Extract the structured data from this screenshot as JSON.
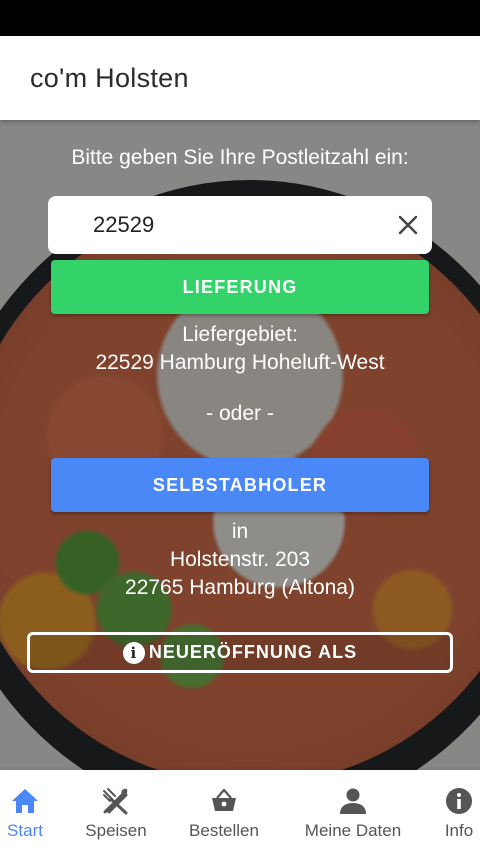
{
  "app": {
    "title": "co'm Holsten"
  },
  "zip_prompt": "Bitte geben Sie Ihre Postleitzahl ein:",
  "zip_input": {
    "value": "22529"
  },
  "delivery": {
    "button_label": "LIEFERUNG",
    "area_label": "Liefergebiet:",
    "area_value": "22529 Hamburg Hoheluft-West"
  },
  "or_text": "- oder -",
  "pickup": {
    "button_label": "SELBSTABHOLER",
    "in_label": "in",
    "street": "Holstenstr. 203",
    "city": "22765 Hamburg (Altona)"
  },
  "opening_button_label": "NEUERÖFFNUNG ALS",
  "colors": {
    "green": "#33d369",
    "blue": "#4a87f7"
  },
  "bottom_nav": {
    "items": [
      {
        "label": "Start",
        "icon": "home-icon",
        "active": true
      },
      {
        "label": "Speisen",
        "icon": "cutlery-icon",
        "active": false
      },
      {
        "label": "Bestellen",
        "icon": "basket-icon",
        "active": false
      },
      {
        "label": "Meine Daten",
        "icon": "person-icon",
        "active": false
      },
      {
        "label": "Info",
        "icon": "info-icon",
        "active": false
      }
    ]
  }
}
